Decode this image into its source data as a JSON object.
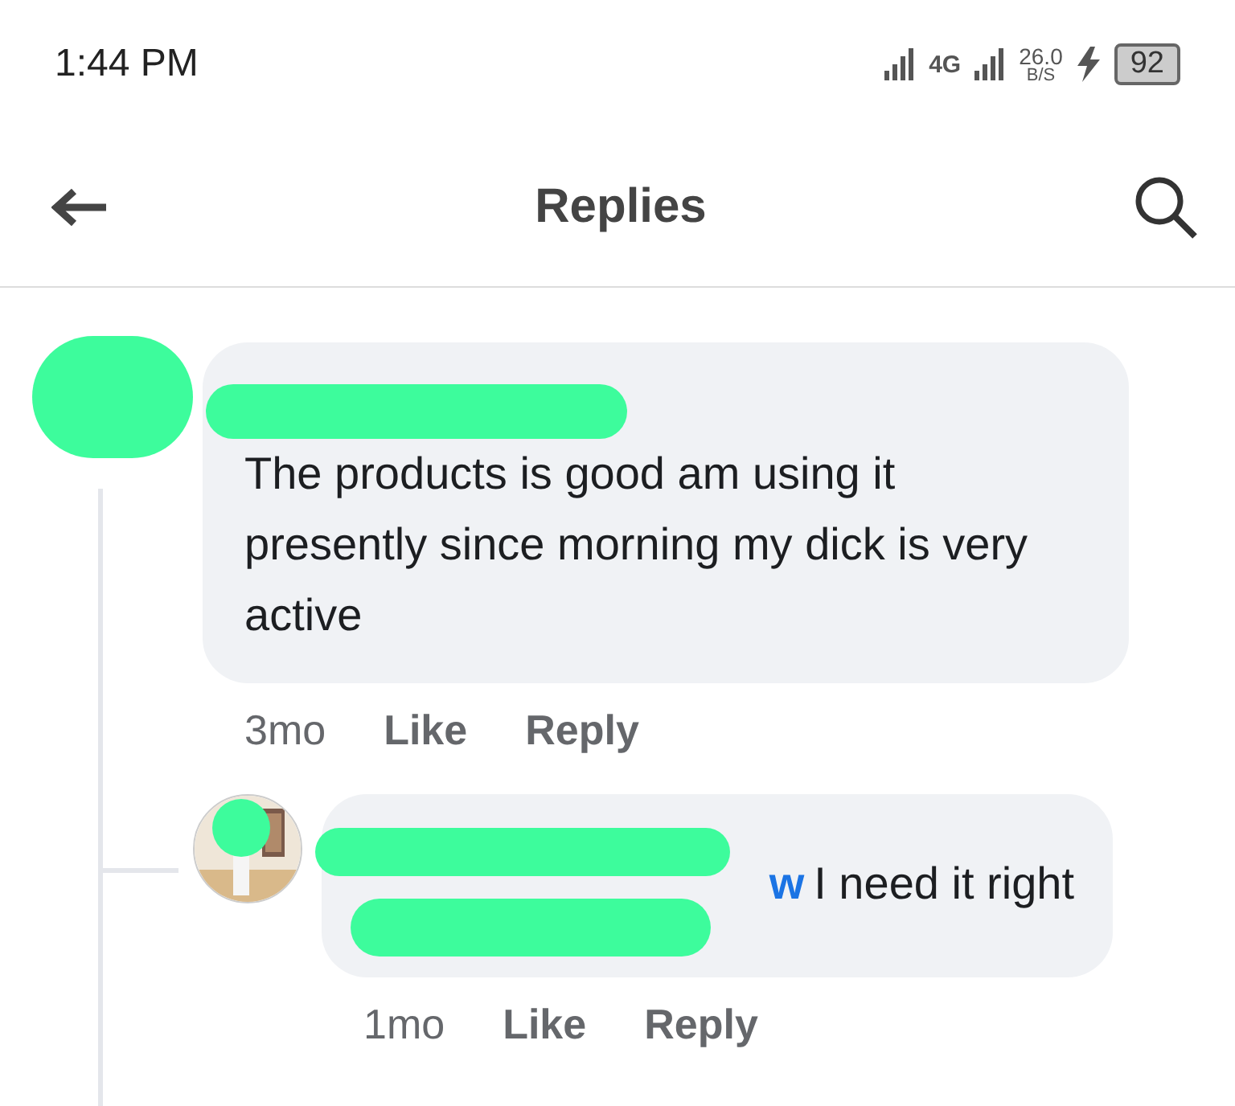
{
  "status_bar": {
    "time": "1:44 PM",
    "network": "4G",
    "speed": "26.0",
    "speed_unit": "B/S",
    "battery": "92"
  },
  "header": {
    "title": "Replies"
  },
  "comments": [
    {
      "text": "The products is good am using it presently since morning my dick is very active",
      "time": "3mo",
      "like": "Like",
      "reply": "Reply",
      "replies": [
        {
          "mention": "w",
          "text": "I need it right",
          "time": "1mo",
          "like": "Like",
          "reply": "Reply"
        }
      ]
    }
  ]
}
